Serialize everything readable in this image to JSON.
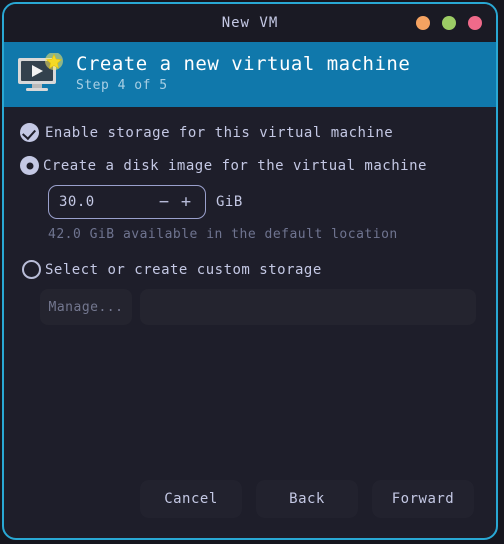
{
  "window": {
    "title": "New VM",
    "border_color": "#29a8d4",
    "background": "#1e1e2a",
    "controls": [
      {
        "name": "minimize",
        "color": "#f4a261"
      },
      {
        "name": "maximize",
        "color": "#9ccc65"
      },
      {
        "name": "close",
        "color": "#ef6a8a"
      }
    ]
  },
  "banner": {
    "title": "Create a new virtual machine",
    "subtitle": "Step 4 of 5",
    "background": "#1078ab",
    "icon": "virtual-machine-new-icon"
  },
  "form": {
    "enable_storage": {
      "label": "Enable storage for this virtual machine",
      "checked": true
    },
    "create_disk_image": {
      "label": "Create a disk image for the virtual machine",
      "selected": true
    },
    "disk_size": {
      "value": "30.0",
      "unit": "GiB",
      "decrement_label": "−",
      "increment_label": "+"
    },
    "storage_hint": "42.0 GiB available in the default location",
    "custom_storage": {
      "label": "Select or create custom storage",
      "selected": false,
      "manage_label": "Manage...",
      "path_value": "",
      "path_placeholder": ""
    }
  },
  "footer": {
    "cancel_label": "Cancel",
    "back_label": "Back",
    "forward_label": "Forward"
  }
}
